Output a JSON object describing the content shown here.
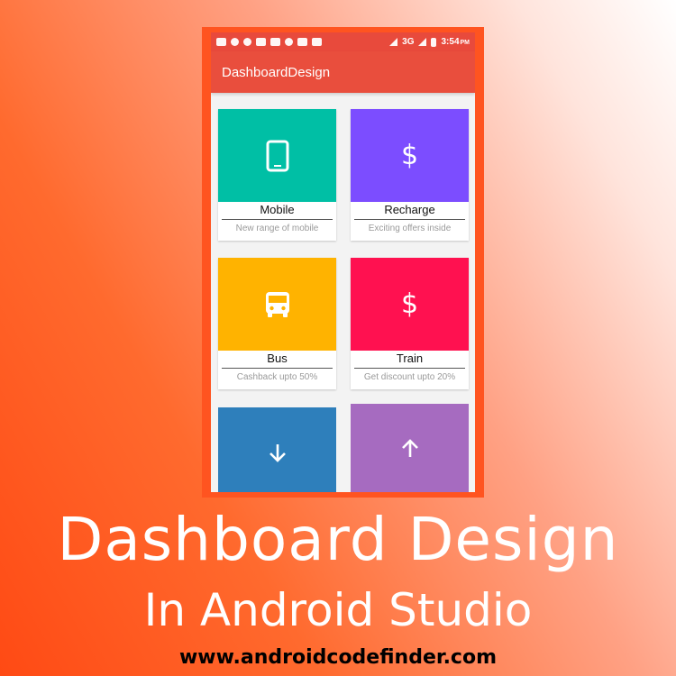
{
  "status_bar": {
    "network": "3G",
    "time": "3:54",
    "ampm": "PM"
  },
  "app_bar": {
    "title": "DashboardDesign"
  },
  "cards": [
    {
      "title": "Mobile",
      "subtitle": "New range of mobile",
      "color": "#00bfa5",
      "icon": "smartphone-icon"
    },
    {
      "title": "Recharge",
      "subtitle": "Exciting offers inside",
      "color": "#7c4dff",
      "icon": "dollar-icon",
      "glyph": "$"
    },
    {
      "title": "Bus",
      "subtitle": "Cashback upto 50%",
      "color": "#ffb300",
      "icon": "bus-icon"
    },
    {
      "title": "Train",
      "subtitle": "Get discount upto 20%",
      "color": "#ff1150",
      "icon": "dollar-icon",
      "glyph": "$"
    },
    {
      "color": "#2e7fbb",
      "icon": "arrow-down-icon"
    },
    {
      "color": "#a66bc0",
      "icon": "arrow-up-icon"
    }
  ],
  "banner": {
    "title": "Dashboard Design",
    "subtitle": "In Android Studio",
    "url": "www.androidcodefinder.com"
  },
  "colors": {
    "frame": "#ff5420",
    "app_bar": "#e94e3d"
  }
}
